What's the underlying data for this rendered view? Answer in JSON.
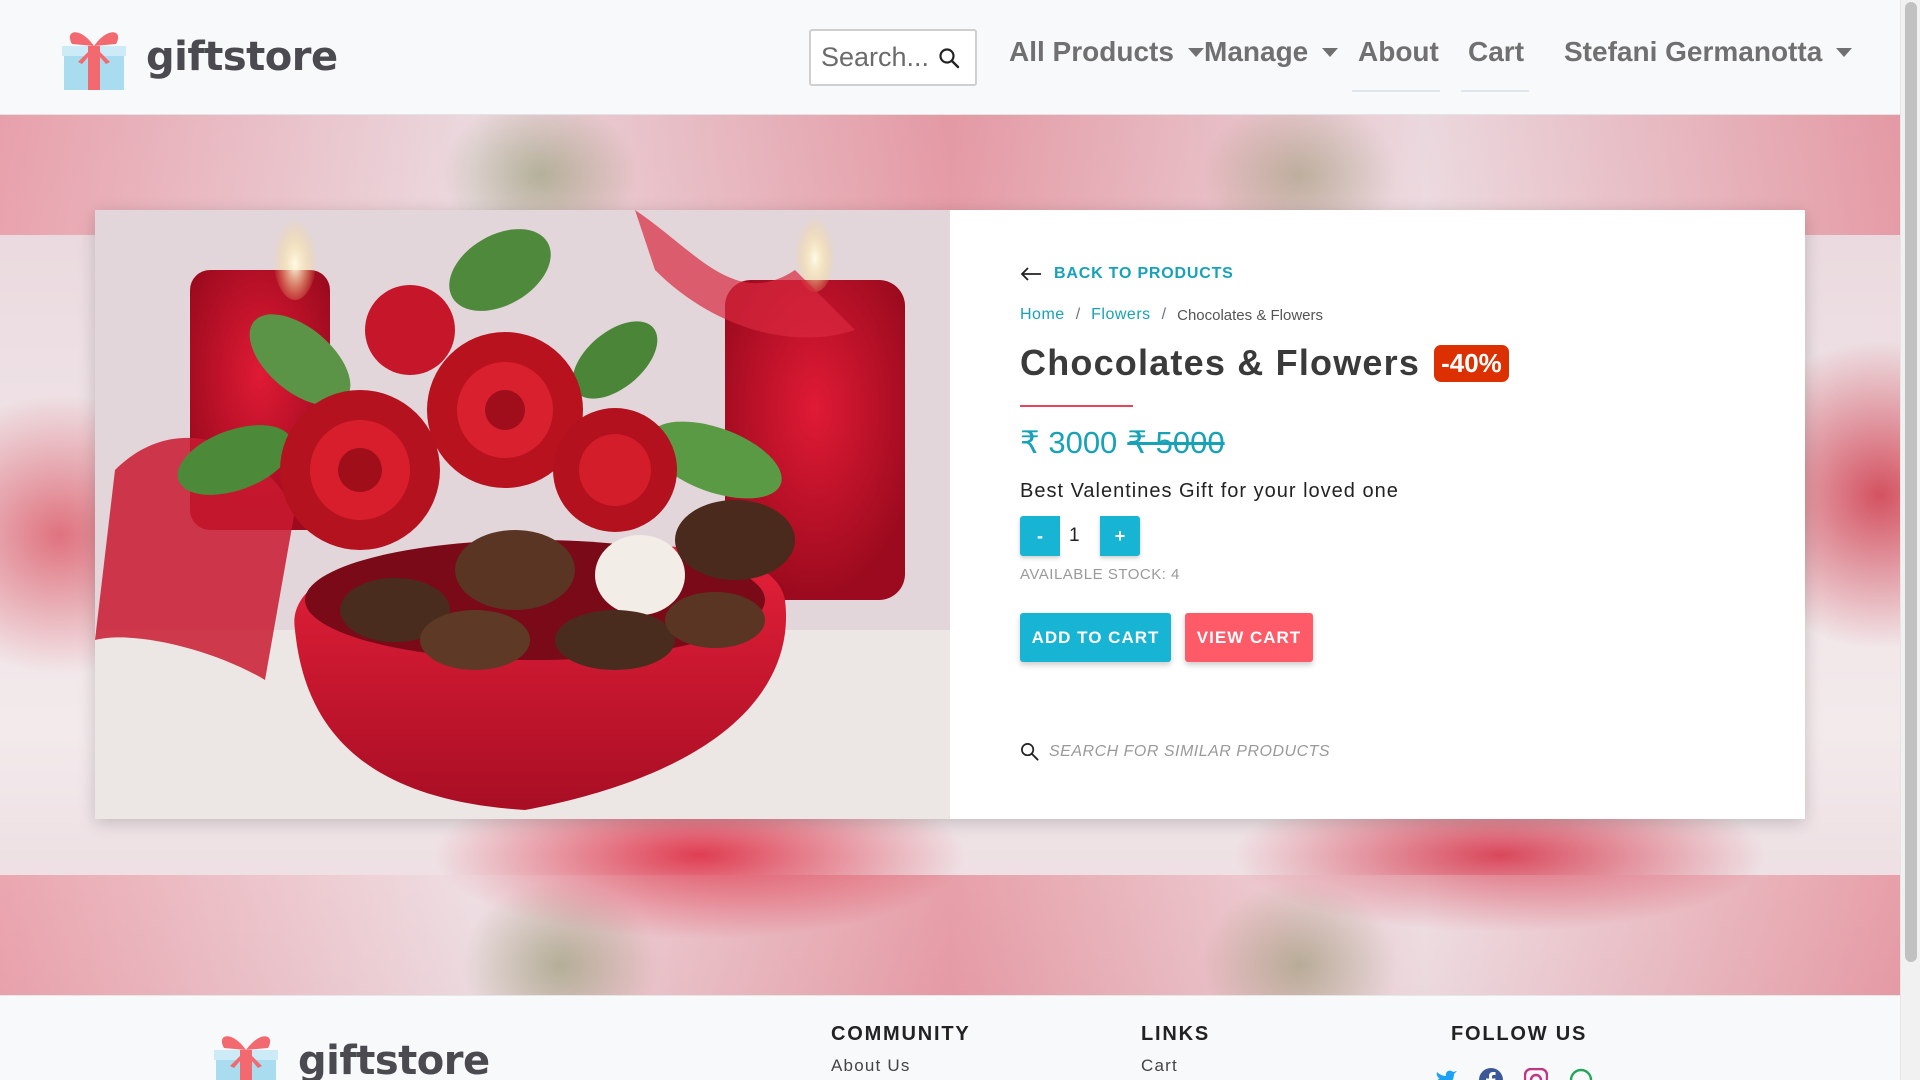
{
  "header": {
    "brand": "giftstore",
    "search_placeholder": "Search...",
    "nav": {
      "all_products": "All Products",
      "manage": "Manage",
      "about": "About",
      "cart": "Cart",
      "user": "Stefani Germanotta"
    }
  },
  "product": {
    "back_label": "BACK TO PRODUCTS",
    "breadcrumb": {
      "home": "Home",
      "category": "Flowers",
      "current": "Chocolates & Flowers"
    },
    "title": "Chocolates & Flowers",
    "discount": "-40%",
    "price": "₹ 3000",
    "original_price": "₹ 5000",
    "description": "Best Valentines Gift for your loved one",
    "quantity": {
      "minus": "-",
      "plus": "+",
      "value": "1"
    },
    "stock_label": "AVAILABLE STOCK: 4",
    "add_to_cart": "ADD TO CART",
    "view_cart": "VIEW CART",
    "search_similar_placeholder": "SEARCH FOR SIMILAR PRODUCTS"
  },
  "footer": {
    "brand": "giftstore",
    "community": {
      "title": "COMMUNITY",
      "link": "About Us"
    },
    "links": {
      "title": "LINKS",
      "link": "Cart"
    },
    "follow": {
      "title": "FOLLOW US",
      "icons": [
        "twitter-icon",
        "facebook-icon",
        "instagram-icon",
        "whatsapp-icon"
      ]
    }
  },
  "colors": {
    "accent": "#17a2b8",
    "button_primary": "#17b5d3",
    "button_danger": "#ff5a68",
    "discount_badge": "#dc3000"
  }
}
